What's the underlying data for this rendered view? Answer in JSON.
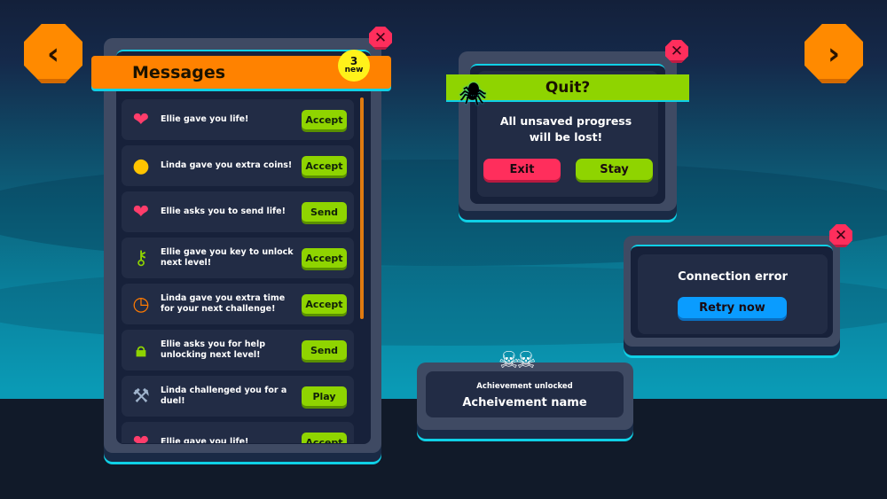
{
  "nav": {
    "prev_icon": "chevron-left-icon",
    "next_icon": "chevron-right-icon",
    "prev": "‹",
    "next": "›"
  },
  "close_glyph": "✕",
  "messages": {
    "title": "Messages",
    "badge": {
      "count": "3",
      "label": "new"
    },
    "items": [
      {
        "icon": "heart-icon",
        "glyph": "❤",
        "color": "#ff3d6b",
        "text": "Ellie gave you life!",
        "action": "Accept"
      },
      {
        "icon": "coin-icon",
        "glyph": "●",
        "color": "#ffc400",
        "text": "Linda gave you extra coins!",
        "action": "Accept"
      },
      {
        "icon": "heart-icon",
        "glyph": "❤",
        "color": "#ff3d6b",
        "text": "Ellie asks you to send life!",
        "action": "Send"
      },
      {
        "icon": "skull-key-icon",
        "glyph": "⚷",
        "color": "#8fd400",
        "text": "Ellie gave you key to unlock next level!",
        "action": "Accept"
      },
      {
        "icon": "clock-icon",
        "glyph": "◷",
        "color": "#ff7a00",
        "text": "Linda gave you extra time for your next challenge!",
        "action": "Accept"
      },
      {
        "icon": "lock-icon",
        "glyph": "🔒︎",
        "color": "#8fd400",
        "text": "Ellie asks you for help unlocking next level!",
        "action": "Send"
      },
      {
        "icon": "axe-icon",
        "glyph": "⚒",
        "color": "#9fb3cc",
        "text": "Linda challenged you for a duel!",
        "action": "Play"
      },
      {
        "icon": "heart-icon",
        "glyph": "❤",
        "color": "#ff3d6b",
        "text": "Ellie gave you life!",
        "action": "Accept"
      }
    ]
  },
  "quit": {
    "title": "Quit?",
    "message": "All unsaved progress will be lost!",
    "exit": "Exit",
    "stay": "Stay"
  },
  "connection": {
    "title": "Connection error",
    "retry": "Retry now"
  },
  "achievement": {
    "subtitle": "Achievement unlocked",
    "name": "Acheivement name"
  },
  "colors": {
    "orange": "#ff8200",
    "green": "#8fd400",
    "red": "#ff2e5c",
    "blue": "#0a9cff"
  }
}
